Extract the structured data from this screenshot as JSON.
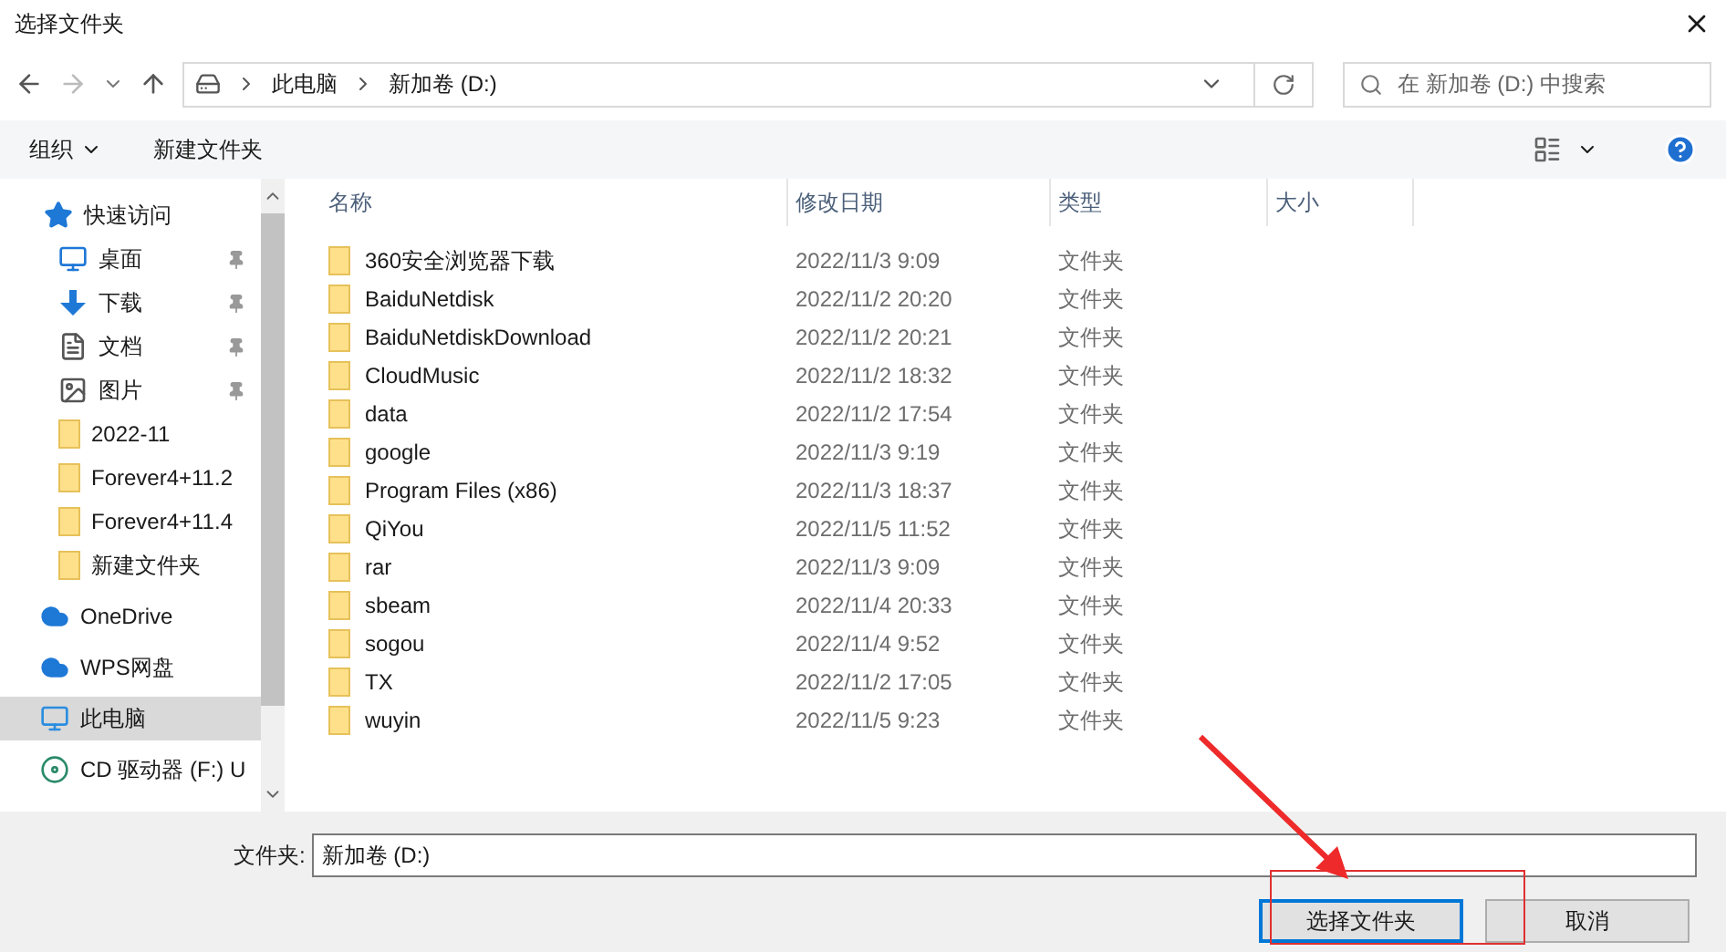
{
  "window": {
    "title": "选择文件夹"
  },
  "address": {
    "crumbs": [
      "此电脑",
      "新加卷 (D:)"
    ]
  },
  "search": {
    "placeholder": "在 新加卷 (D:) 中搜索"
  },
  "toolbar": {
    "organize": "组织",
    "new_folder": "新建文件夹"
  },
  "sidebar": {
    "items": [
      {
        "kind": "star",
        "label": "快速访问",
        "pinned": false,
        "selected": false,
        "children": [
          {
            "kind": "desktop",
            "label": "桌面",
            "pinned": true,
            "selected": false
          },
          {
            "kind": "download",
            "label": "下载",
            "pinned": true,
            "selected": false
          },
          {
            "kind": "document",
            "label": "文档",
            "pinned": true,
            "selected": false
          },
          {
            "kind": "picture",
            "label": "图片",
            "pinned": true,
            "selected": false
          },
          {
            "kind": "folder",
            "label": "2022-11",
            "pinned": false,
            "selected": false
          },
          {
            "kind": "folder",
            "label": "Forever4+11.2",
            "pinned": false,
            "selected": false
          },
          {
            "kind": "folder",
            "label": "Forever4+11.4",
            "pinned": false,
            "selected": false
          },
          {
            "kind": "folder",
            "label": "新建文件夹",
            "pinned": false,
            "selected": false
          }
        ]
      },
      {
        "kind": "cloud",
        "label": "OneDrive",
        "pinned": false,
        "selected": false
      },
      {
        "kind": "cloud",
        "label": "WPS网盘",
        "pinned": false,
        "selected": false
      },
      {
        "kind": "computer",
        "label": "此电脑",
        "pinned": false,
        "selected": true
      },
      {
        "kind": "disc",
        "label": "CD 驱动器 (F:) U",
        "pinned": false,
        "selected": false
      }
    ]
  },
  "table": {
    "columns": [
      "名称",
      "修改日期",
      "类型",
      "大小"
    ],
    "rows": [
      {
        "name": "360安全浏览器下载",
        "date": "2022/11/3 9:09",
        "type": "文件夹"
      },
      {
        "name": "BaiduNetdisk",
        "date": "2022/11/2 20:20",
        "type": "文件夹"
      },
      {
        "name": "BaiduNetdiskDownload",
        "date": "2022/11/2 20:21",
        "type": "文件夹"
      },
      {
        "name": "CloudMusic",
        "date": "2022/11/2 18:32",
        "type": "文件夹"
      },
      {
        "name": "data",
        "date": "2022/11/2 17:54",
        "type": "文件夹"
      },
      {
        "name": "google",
        "date": "2022/11/3 9:19",
        "type": "文件夹"
      },
      {
        "name": "Program Files (x86)",
        "date": "2022/11/3 18:37",
        "type": "文件夹"
      },
      {
        "name": "QiYou",
        "date": "2022/11/5 11:52",
        "type": "文件夹"
      },
      {
        "name": "rar",
        "date": "2022/11/3 9:09",
        "type": "文件夹"
      },
      {
        "name": "sbeam",
        "date": "2022/11/4 20:33",
        "type": "文件夹"
      },
      {
        "name": "sogou",
        "date": "2022/11/4 9:52",
        "type": "文件夹"
      },
      {
        "name": "TX",
        "date": "2022/11/2 17:05",
        "type": "文件夹"
      },
      {
        "name": "wuyin",
        "date": "2022/11/5 9:23",
        "type": "文件夹"
      }
    ]
  },
  "folder_field": {
    "label": "文件夹:",
    "value": "新加卷 (D:)"
  },
  "buttons": [
    {
      "label": "选择文件夹",
      "kind": "primary"
    },
    {
      "label": "取消",
      "kind": "normal"
    }
  ]
}
